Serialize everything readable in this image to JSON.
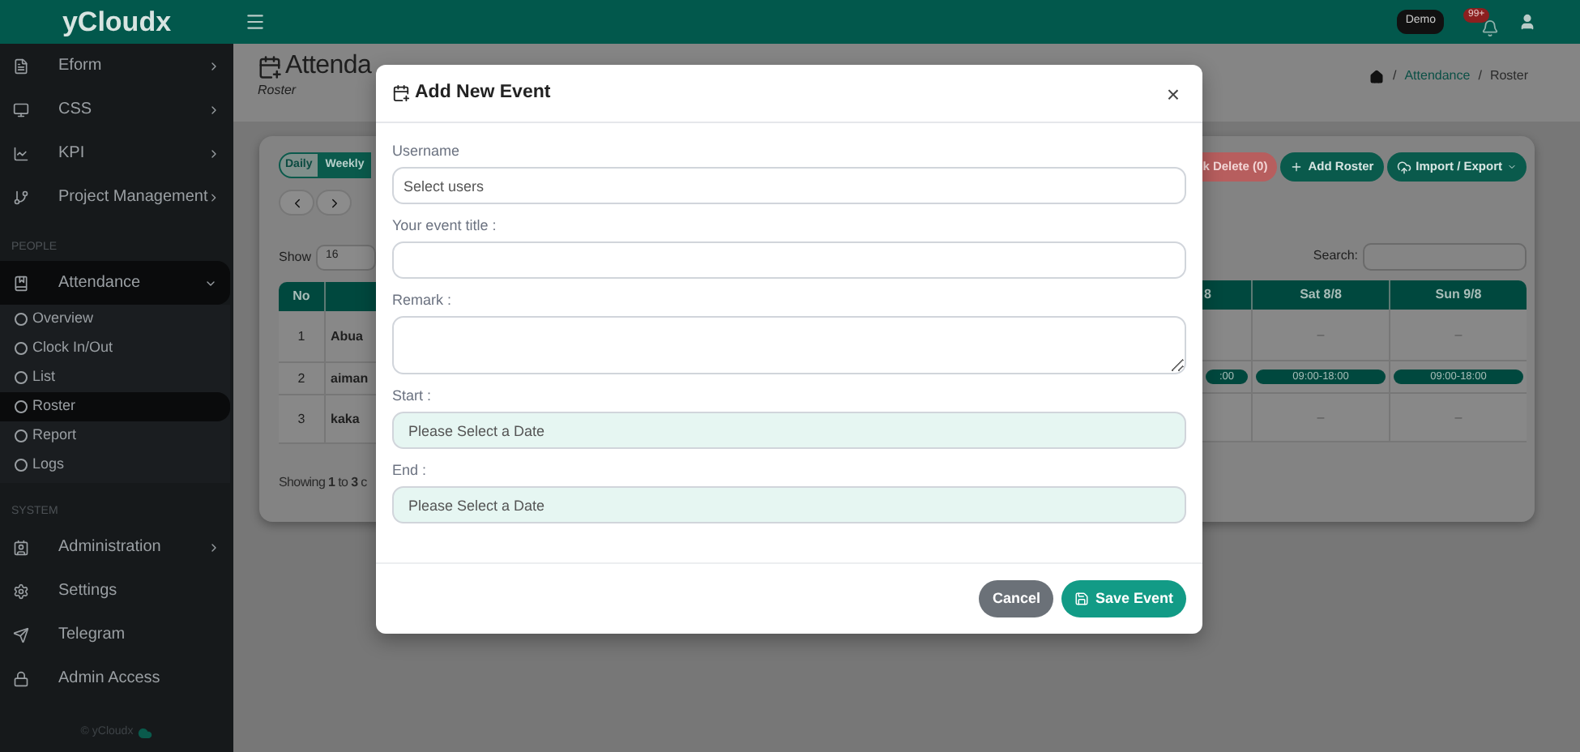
{
  "topbar": {
    "brand": "yCloudx",
    "badge": "Demo",
    "notification_count": "99+"
  },
  "sidebar": {
    "items": [
      {
        "kind": "menu",
        "label": "Eform",
        "selected": false,
        "expanded": false
      },
      {
        "kind": "menu",
        "label": "CSS",
        "selected": false,
        "expanded": false
      },
      {
        "kind": "menu",
        "label": "KPI",
        "selected": false,
        "expanded": false
      },
      {
        "kind": "menu",
        "label": "Project Management",
        "selected": false,
        "expanded": false
      },
      {
        "kind": "heading",
        "label": "PEOPLE"
      },
      {
        "kind": "menu",
        "label": "Attendance",
        "selected": true,
        "expanded": true,
        "children": [
          {
            "label": "Overview",
            "selected": false
          },
          {
            "label": "Clock In/Out",
            "selected": false
          },
          {
            "label": "List",
            "selected": false
          },
          {
            "label": "Roster",
            "selected": true
          },
          {
            "label": "Report",
            "selected": false
          },
          {
            "label": "Logs",
            "selected": false
          }
        ]
      },
      {
        "kind": "heading",
        "label": "SYSTEM"
      },
      {
        "kind": "menu",
        "label": "Administration",
        "selected": false,
        "expanded": false
      },
      {
        "kind": "link",
        "label": "Settings",
        "selected": false
      },
      {
        "kind": "link",
        "label": "Telegram",
        "selected": false
      },
      {
        "kind": "link",
        "label": "Admin Access",
        "selected": false
      }
    ],
    "footer": "© yCloudx"
  },
  "page": {
    "title": "Attenda",
    "subtitle": "Roster",
    "breadcrumb": {
      "separator": "/",
      "items": [
        {
          "label": "Attendance",
          "kind": "link"
        },
        {
          "label": "Roster",
          "kind": "current"
        }
      ]
    }
  },
  "roster": {
    "views": [
      {
        "label": "Daily",
        "selected": false
      },
      {
        "label": "Weekly",
        "selected": true
      }
    ],
    "show_label": "Show",
    "page_size": "16",
    "actions": [
      {
        "label": "k Delete (0)",
        "kind": "danger"
      },
      {
        "label": "Add Roster",
        "kind": "add"
      },
      {
        "label": "Import / Export",
        "kind": "menu"
      }
    ],
    "search_label": "Search:",
    "left_columns": [
      "No"
    ],
    "right_columns": [
      "8",
      "Sat 8/8",
      "Sun 9/8"
    ],
    "rows": [
      {
        "no": "1",
        "name": "Abua",
        "cells": [
          {
            "kind": "empty"
          },
          {
            "kind": "dash",
            "text": "–"
          },
          {
            "kind": "dash",
            "text": "–"
          }
        ]
      },
      {
        "no": "2",
        "name": "aiman",
        "cells": [
          {
            "kind": "shift",
            "text": ":00"
          },
          {
            "kind": "shift",
            "text": "09:00-18:00"
          },
          {
            "kind": "shift",
            "text": "09:00-18:00"
          }
        ]
      },
      {
        "no": "3",
        "name": "kaka",
        "cells": [
          {
            "kind": "empty"
          },
          {
            "kind": "dash",
            "text": "–"
          },
          {
            "kind": "dash",
            "text": "–"
          }
        ]
      }
    ],
    "footer": "Showing **1** to **3** c"
  },
  "modal": {
    "title": "Add New Event",
    "close": "×",
    "fields": [
      {
        "label": "Username",
        "kind": "select",
        "placeholder": "Select users"
      },
      {
        "label": "Your event title :",
        "kind": "text"
      },
      {
        "label": "Remark :",
        "kind": "textarea"
      },
      {
        "label": "Start :",
        "kind": "date",
        "placeholder": "Please Select a Date"
      },
      {
        "label": "End :",
        "kind": "date",
        "placeholder": "Please Select a Date"
      }
    ],
    "buttons": [
      {
        "label": "Cancel",
        "kind": "secondary"
      },
      {
        "label": "Save Event",
        "kind": "primary"
      }
    ]
  }
}
